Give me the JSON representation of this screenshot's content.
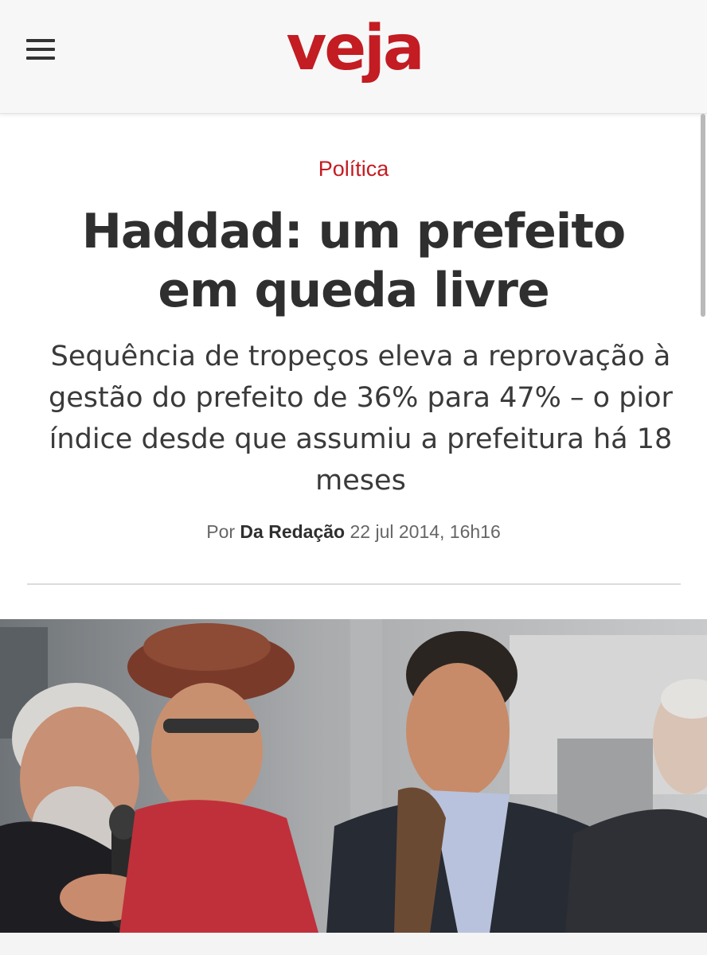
{
  "header": {
    "logo_text": "veja",
    "brand_color": "#c31c22",
    "menu_icon": "hamburger-menu-icon"
  },
  "article": {
    "category": "Política",
    "headline": "Haddad: um prefeito em queda livre",
    "subtitle": "Sequência de tropeços eleva a reprovação à gestão do prefeito de 36% para 47% – o pior índice desde que assumiu a prefeitura há 18 meses",
    "byline_prefix": "Por",
    "author": "Da Redação",
    "date": "22 jul 2014, 16h16"
  }
}
